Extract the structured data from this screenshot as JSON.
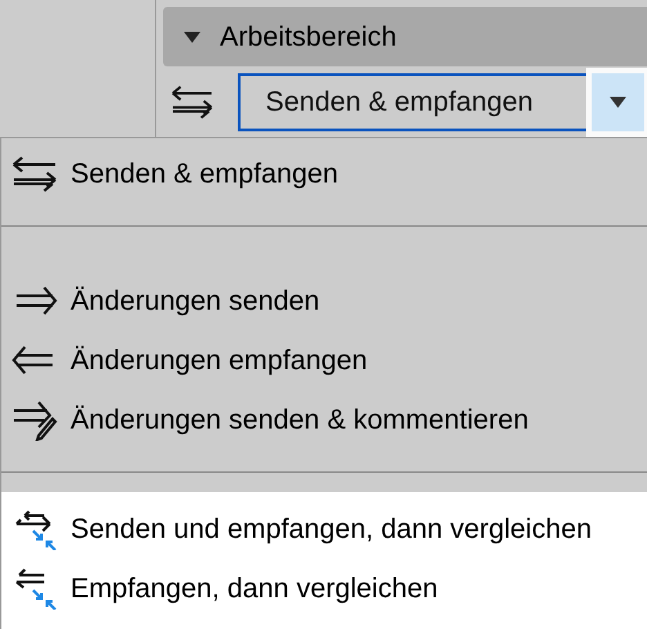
{
  "panel": {
    "header": {
      "label": "Arbeitsbereich",
      "expanded": true
    },
    "action": {
      "kind": "sync",
      "value": "Senden & empfangen"
    }
  },
  "menu": {
    "groups": [
      {
        "highlighted": false,
        "items": [
          {
            "kind": "sync",
            "label": "Senden & empfangen"
          }
        ]
      },
      {
        "highlighted": false,
        "items": [
          {
            "kind": "send",
            "label": "Änderungen senden"
          },
          {
            "kind": "receive",
            "label": "Änderungen empfangen"
          },
          {
            "kind": "send-comment",
            "label": "Änderungen senden & kommentieren"
          }
        ]
      },
      {
        "highlighted": true,
        "items": [
          {
            "kind": "sync-compare",
            "label": "Senden und empfangen, dann vergleichen"
          },
          {
            "kind": "receive-compare",
            "label": "Empfangen, dann vergleichen"
          }
        ]
      }
    ]
  }
}
